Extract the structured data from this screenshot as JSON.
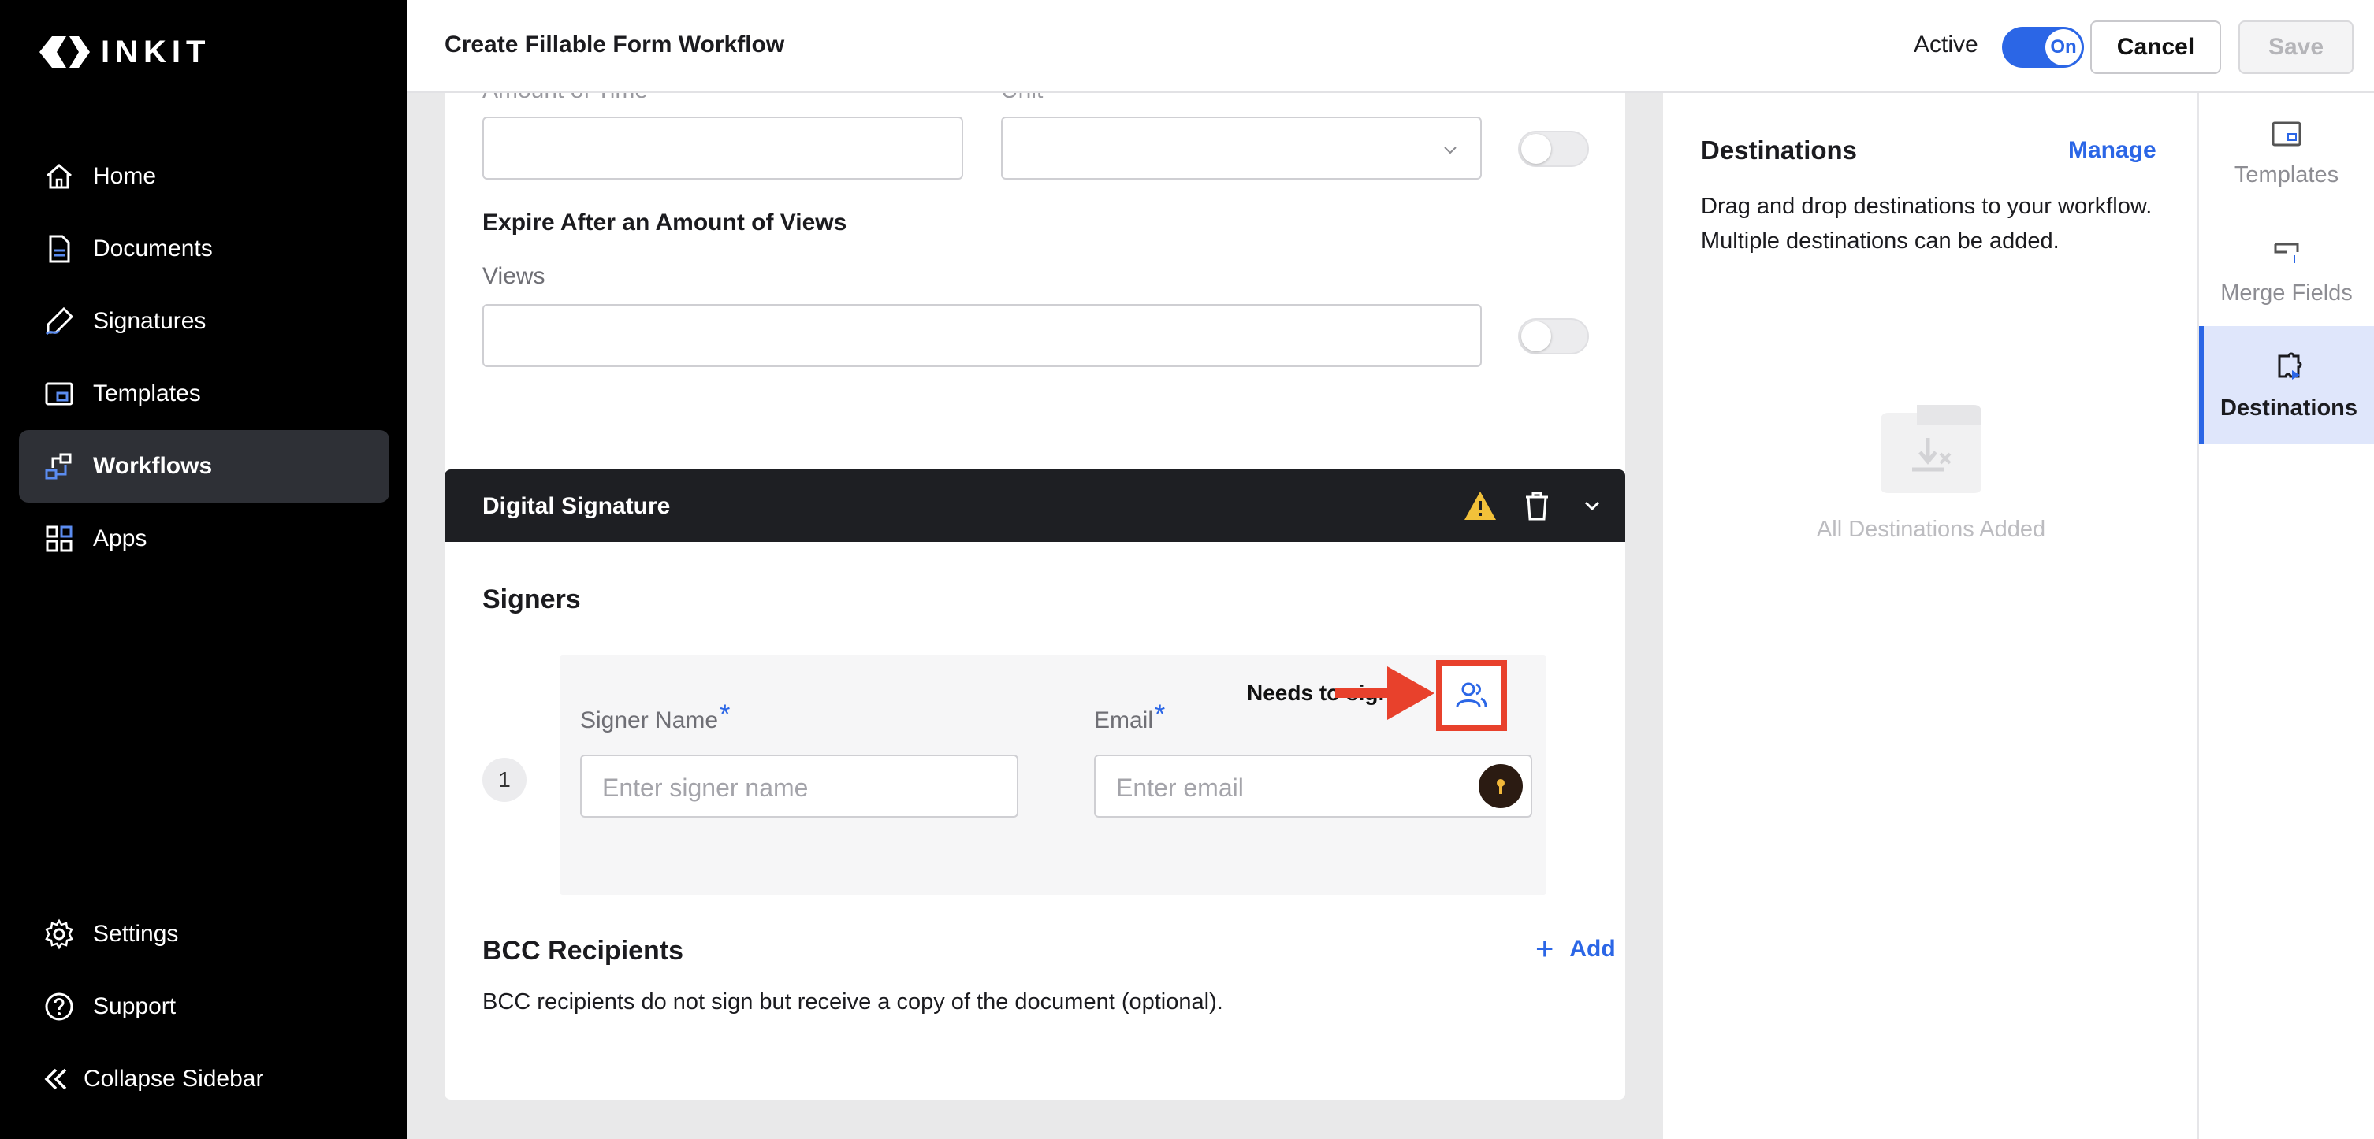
{
  "brand": {
    "name": "INKIT"
  },
  "sidebar": {
    "items": [
      {
        "label": "Home",
        "icon": "home-icon"
      },
      {
        "label": "Documents",
        "icon": "document-icon"
      },
      {
        "label": "Signatures",
        "icon": "signature-pen-icon"
      },
      {
        "label": "Templates",
        "icon": "template-icon"
      },
      {
        "label": "Workflows",
        "icon": "workflow-icon",
        "active": true
      },
      {
        "label": "Apps",
        "icon": "apps-grid-icon"
      }
    ],
    "bottom": [
      {
        "label": "Settings",
        "icon": "gear-icon"
      },
      {
        "label": "Support",
        "icon": "help-circle-icon"
      }
    ],
    "collapse_label": "Collapse Sidebar"
  },
  "header": {
    "title": "Create Fillable Form Workflow",
    "active_label": "Active",
    "toggle_text": "On",
    "cancel_label": "Cancel",
    "save_label": "Save"
  },
  "expiration": {
    "amount_label": "Amount of Time",
    "unit_label": "Unit",
    "amount_value": "",
    "unit_value": "",
    "views_heading": "Expire After an Amount of Views",
    "views_label": "Views",
    "views_value": ""
  },
  "digital_signature": {
    "title": "Digital Signature",
    "signers_heading": "Signers",
    "signer_index": "1",
    "needs_to_sign": "Needs to sign",
    "signer_name_label": "Signer Name",
    "signer_name_placeholder": "Enter signer name",
    "email_label": "Email",
    "email_placeholder": "Enter email",
    "required_mark": "*",
    "bcc_heading": "BCC Recipients",
    "add_label": "Add",
    "bcc_description": "BCC recipients do not sign but receive a copy of the document (optional)."
  },
  "destinations": {
    "title": "Destinations",
    "manage_label": "Manage",
    "description": "Drag and drop destinations to your workflow. Multiple destinations can be added.",
    "empty_text": "All Destinations Added"
  },
  "rail": {
    "tabs": [
      {
        "label": "Templates",
        "icon": "template-icon"
      },
      {
        "label": "Merge Fields",
        "icon": "merge-field-icon"
      },
      {
        "label": "Destinations",
        "icon": "destination-icon",
        "active": true
      }
    ]
  },
  "colors": {
    "accent": "#2b66e6",
    "sidebar_bg": "#000000",
    "active_nav_bg": "#2e3036",
    "annotation_red": "#e8412c",
    "warning": "#f2c13a"
  }
}
